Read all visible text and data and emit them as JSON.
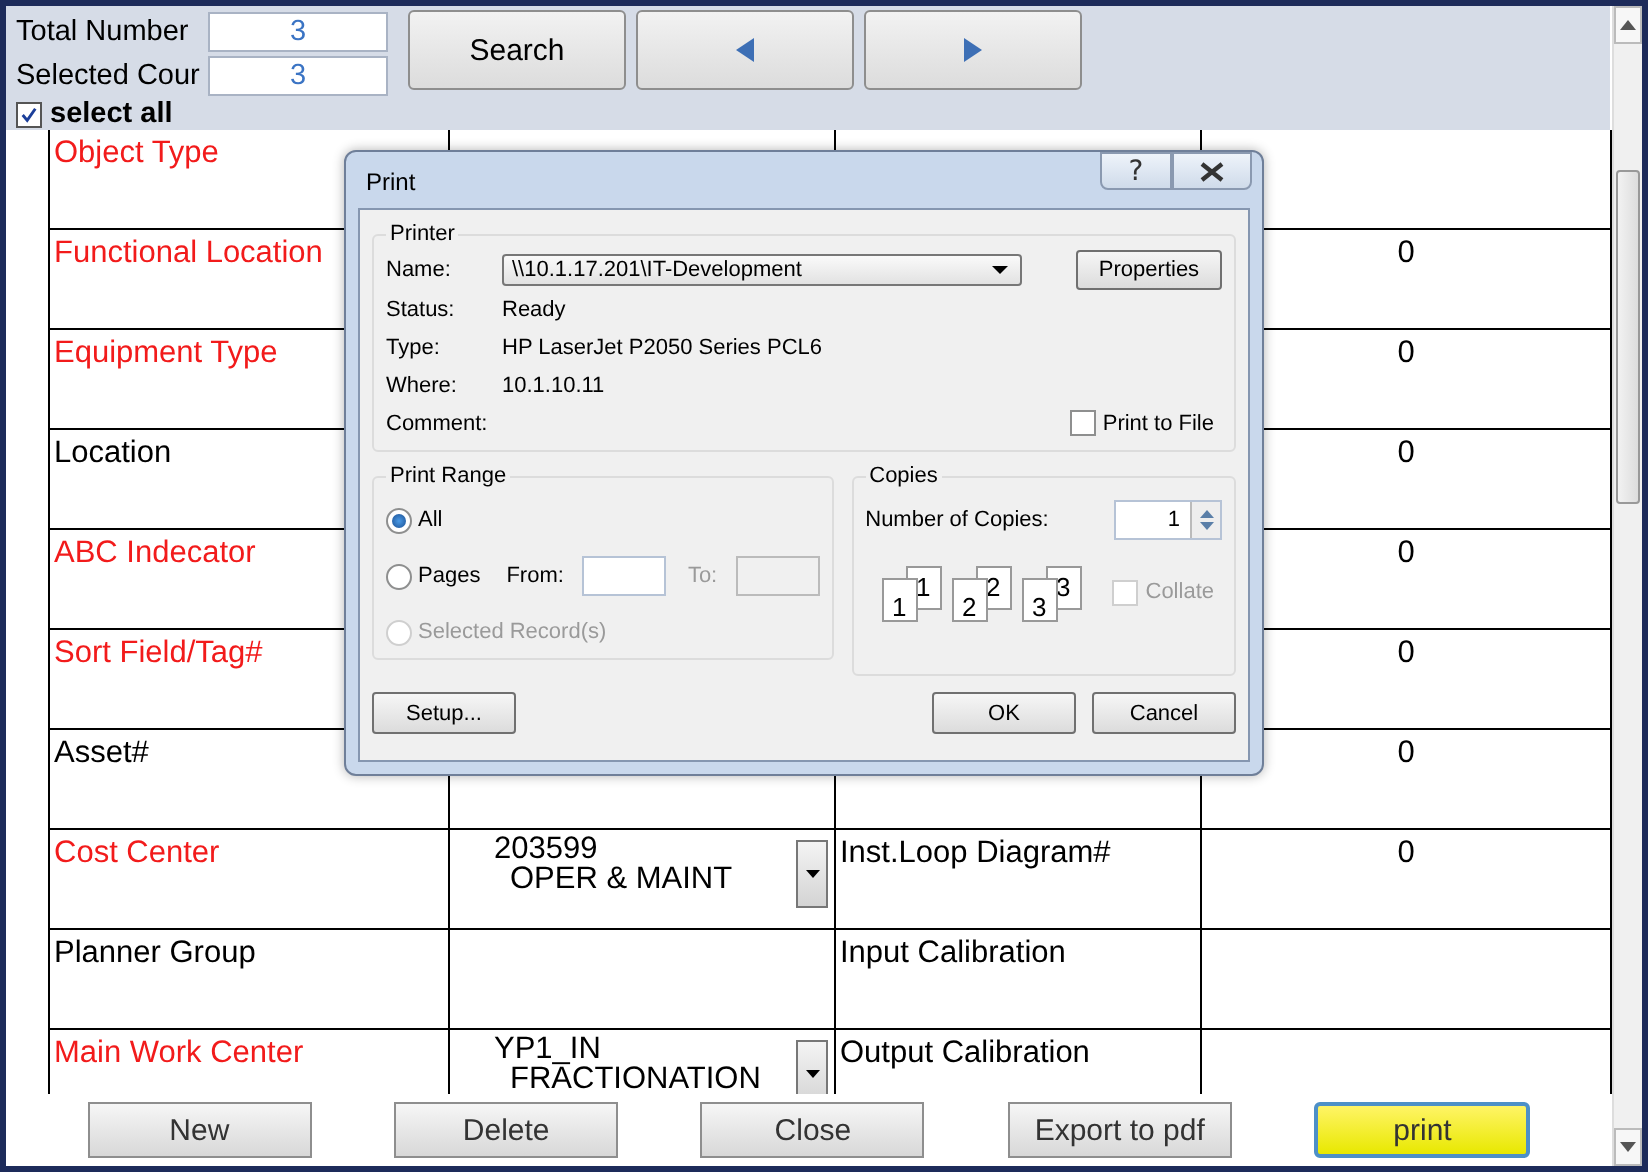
{
  "toolbar": {
    "total_label": "Total Number",
    "total_value": "3",
    "selected_label": "Selected Cour",
    "selected_value": "3",
    "search": "Search",
    "select_all": {
      "label": "select all",
      "checked": true
    }
  },
  "table": {
    "rows": [
      {
        "label": "Object Type",
        "required": true,
        "value": [],
        "label_2": "",
        "value_2": ""
      },
      {
        "label": "Functional Location",
        "required": true,
        "value": [],
        "label_2": "",
        "value_2": "0"
      },
      {
        "label": "Equipment Type",
        "required": true,
        "value": [],
        "label_2": "",
        "value_2": "0"
      },
      {
        "label": "Location",
        "required": false,
        "value": [],
        "label_2": "",
        "value_2": "0"
      },
      {
        "label": "ABC Indecator",
        "required": true,
        "value": [],
        "label_2": "",
        "value_2": "0"
      },
      {
        "label": "Sort Field/Tag#",
        "required": true,
        "value": [],
        "label_2": "",
        "value_2": "0"
      },
      {
        "label": "Asset#",
        "required": false,
        "value": [],
        "label_2": "",
        "value_2": "0"
      },
      {
        "label": "Cost Center",
        "required": true,
        "value": [
          "203599",
          "OPER & MAINT"
        ],
        "label_2": "Inst.Loop Diagram#",
        "value_2": "0"
      },
      {
        "label": "Planner Group",
        "required": false,
        "value": [],
        "label_2": "Input Calibration",
        "value_2": ""
      },
      {
        "label": "Main Work Center",
        "required": true,
        "value": [
          "YP1_IN",
          "FRACTIONATION"
        ],
        "label_2": "Output Calibration",
        "value_2": ""
      }
    ]
  },
  "buttons": [
    {
      "label": "New",
      "highlighted": false
    },
    {
      "label": "Delete",
      "highlighted": false
    },
    {
      "label": "Close",
      "highlighted": false
    },
    {
      "label": "Export to pdf",
      "highlighted": false
    },
    {
      "label": "print",
      "highlighted": true
    }
  ],
  "dialog": {
    "title": "Print",
    "help": "?",
    "printer": {
      "legend": "Printer",
      "name_label": "Name:",
      "name_value": "\\\\10.1.17.201\\IT-Development",
      "properties": "Properties",
      "status_label": "Status:",
      "status": "Ready",
      "type_label": "Type:",
      "type": "HP LaserJet P2050 Series PCL6",
      "where_label": "Where:",
      "where": "10.1.10.11",
      "comment_label": "Comment:",
      "print_to_file": {
        "label": "Print to File",
        "checked": false
      }
    },
    "range": {
      "legend": "Print Range",
      "options": [
        {
          "label": "All",
          "selected": true,
          "disabled": false
        },
        {
          "label": "Pages",
          "selected": false,
          "disabled": false
        },
        {
          "label": "Selected Record(s)",
          "selected": false,
          "disabled": true
        }
      ],
      "from_label": "From:",
      "to_label": "To:",
      "to_disabled": true
    },
    "copies": {
      "legend": "Copies",
      "count_label": "Number of Copies:",
      "count": "1",
      "pages": [
        {
          "back": "1",
          "front": "1"
        },
        {
          "back": "2",
          "front": "2"
        },
        {
          "back": "3",
          "front": "3"
        }
      ],
      "collate": {
        "label": "Collate",
        "checked": false,
        "disabled": true
      }
    },
    "setup": "Setup...",
    "ok": "OK",
    "cancel": "Cancel"
  }
}
